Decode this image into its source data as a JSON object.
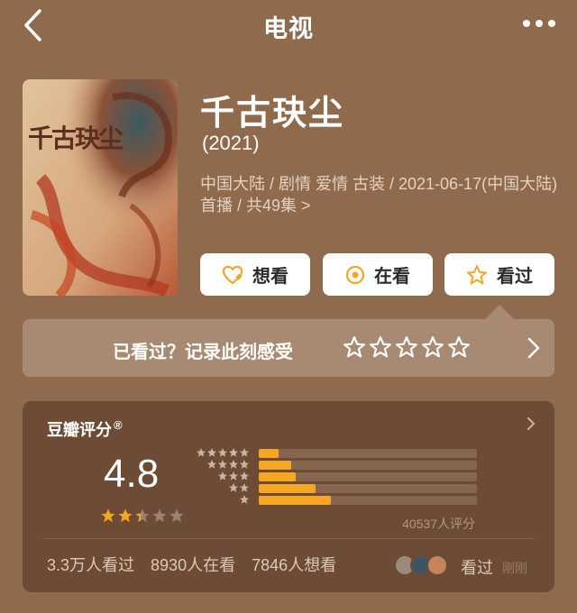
{
  "header": {
    "title": "电视",
    "back_icon": "chevron-left-icon",
    "more_icon": "more-dots-icon"
  },
  "poster": {
    "calligraphy": "千古玦尘"
  },
  "movie": {
    "title": "千古玦尘",
    "year": "(2021)",
    "meta": "中国大陆 / 剧情 爱情 古装 / 2021-06-17(中国大陆)首播 / 共49集 >"
  },
  "actions": {
    "want": "想看",
    "doing": "在看",
    "done": "看过"
  },
  "record": {
    "text": "已看过？记录此刻感受",
    "stars": 5
  },
  "rating": {
    "label": "豆瓣评分",
    "mark": "®",
    "score": "4.8",
    "stars_value": 2.4,
    "distribution": [
      {
        "stars": 5,
        "fraction": 0.09
      },
      {
        "stars": 4,
        "fraction": 0.15
      },
      {
        "stars": 3,
        "fraction": 0.17
      },
      {
        "stars": 2,
        "fraction": 0.26
      },
      {
        "stars": 1,
        "fraction": 0.33
      }
    ],
    "count": "40537人评分",
    "watched": "3.3万人看过",
    "watching": "8930人在看",
    "want": "7846人想看",
    "friends_label": "看过",
    "time": "刚刚"
  },
  "colors": {
    "accent": "#f6a623",
    "background": "#8f6a4d",
    "card": "#6d4b35"
  }
}
